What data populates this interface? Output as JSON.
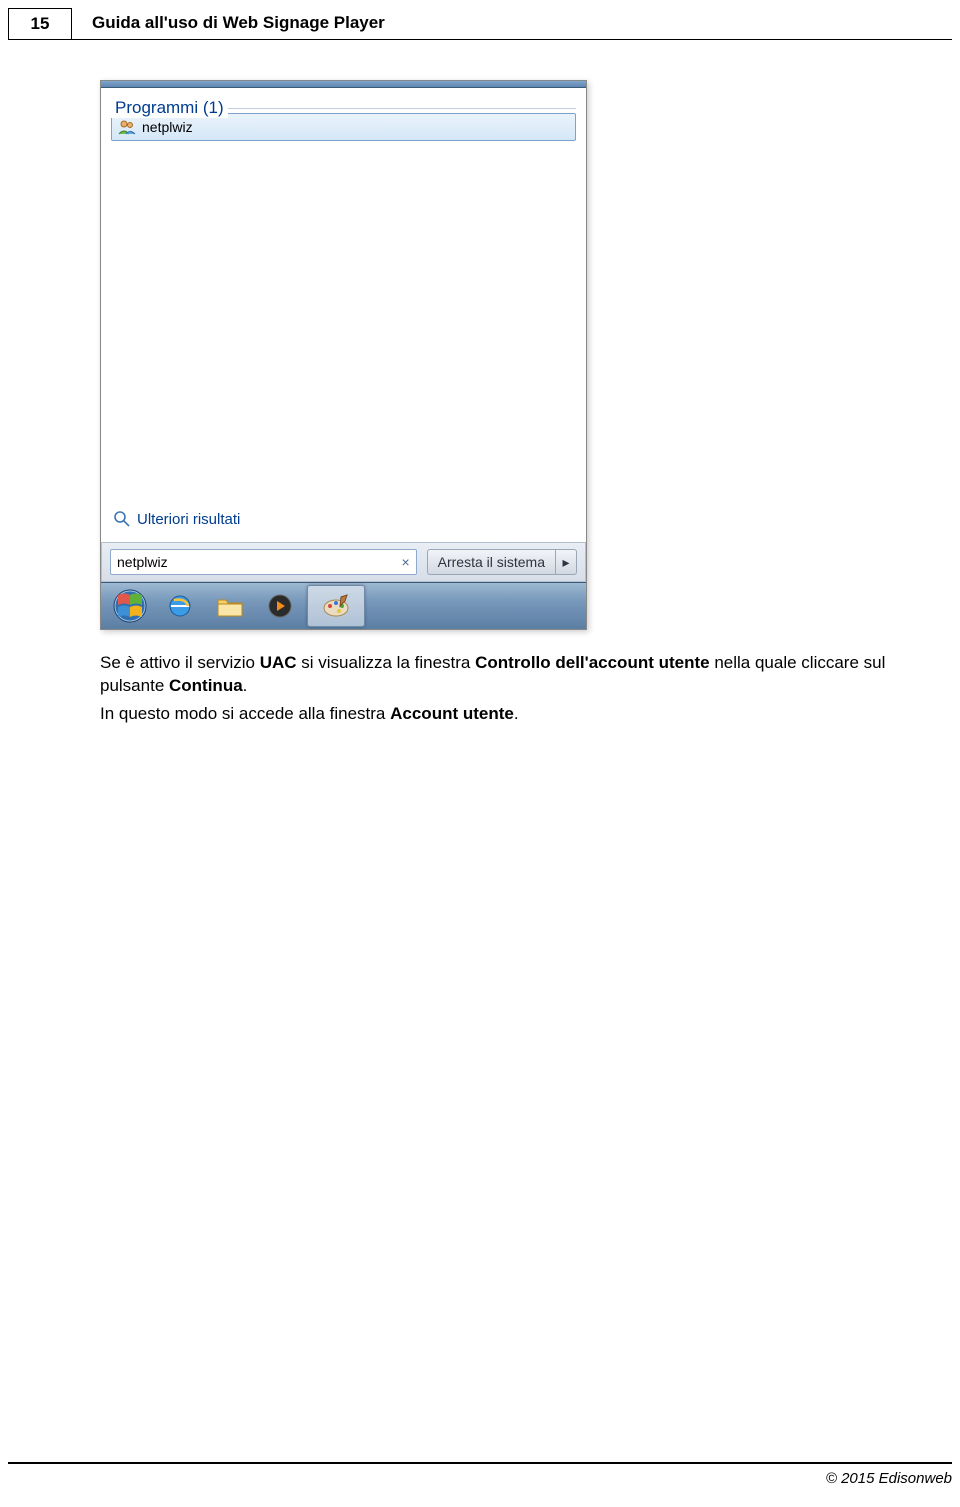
{
  "header": {
    "page_number": "15",
    "title": "Guida all'uso di Web Signage Player"
  },
  "startmenu": {
    "group_label": "Programmi (1)",
    "result_label": "netplwiz",
    "more_results": "Ulteriori risultati",
    "search_value": "netplwiz",
    "shutdown_label": "Arresta il sistema"
  },
  "body": {
    "p1_a": "Se è attivo il servizio ",
    "p1_b": "UAC",
    "p1_c": " si visualizza la finestra ",
    "p1_d": "Controllo dell'account utente",
    "p1_e": " nella quale cliccare sul pulsante ",
    "p1_f": "Continua",
    "p1_g": ".",
    "p2_a": "In questo modo si accede alla finestra ",
    "p2_b": "Account utente",
    "p2_c": "."
  },
  "footer": {
    "copyright": "© 2015 Edisonweb"
  }
}
